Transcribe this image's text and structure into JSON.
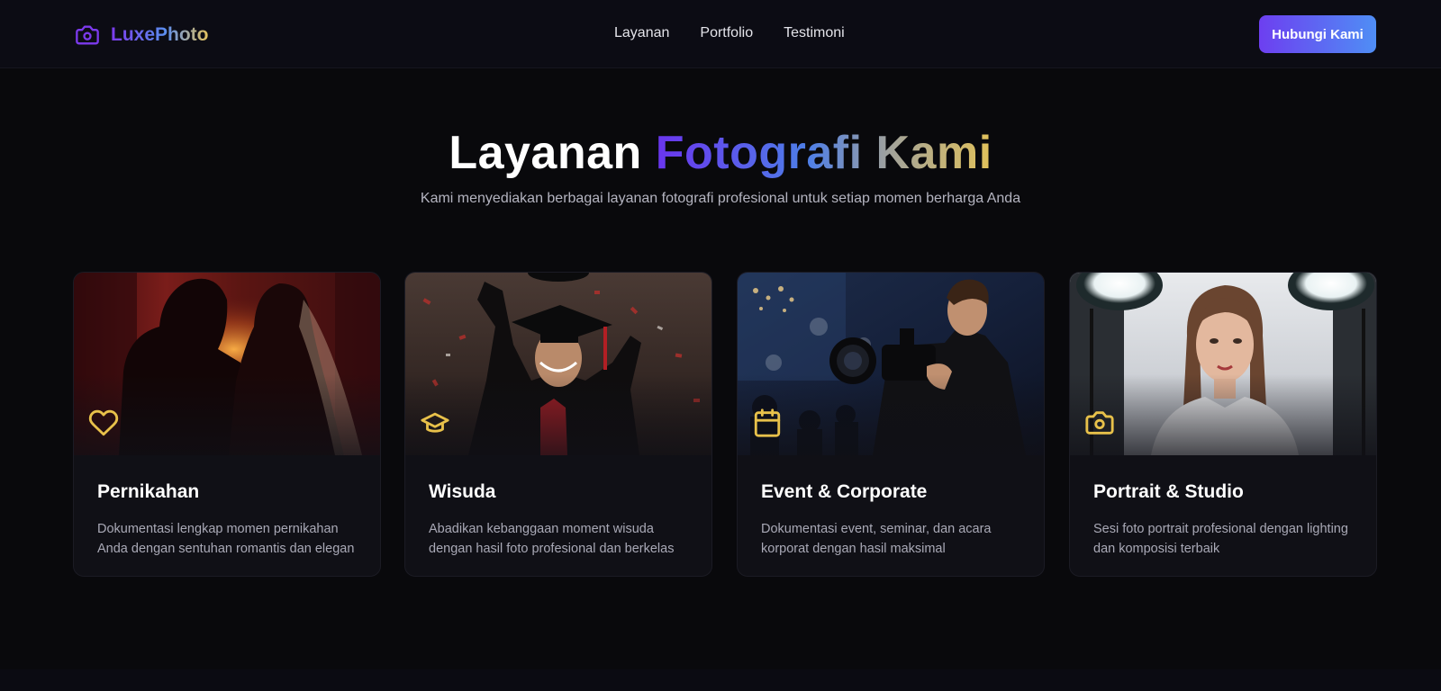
{
  "brand": {
    "name": "LuxePhoto",
    "icon": "camera-icon"
  },
  "nav": {
    "links": [
      "Layanan",
      "Portfolio",
      "Testimoni"
    ],
    "cta_label": "Hubungi Kami"
  },
  "hero": {
    "title_plain": "Layanan",
    "title_gradient": "Fotografi Kami",
    "subtitle": "Kami menyediakan berbagai layanan fotografi profesional untuk setiap momen berharga Anda"
  },
  "services": [
    {
      "title": "Pernikahan",
      "description": "Dokumentasi lengkap momen pernikahan Anda dengan sentuhan romantis dan elegan",
      "icon": "heart-icon"
    },
    {
      "title": "Wisuda",
      "description": "Abadikan kebanggaan moment wisuda dengan hasil foto profesional dan berkelas",
      "icon": "graduation-cap-icon"
    },
    {
      "title": "Event & Corporate",
      "description": "Dokumentasi event, seminar, dan acara korporat dengan hasil maksimal",
      "icon": "calendar-icon"
    },
    {
      "title": "Portrait & Studio",
      "description": "Sesi foto portrait profesional dengan lighting dan komposisi terbaik",
      "icon": "camera-icon"
    }
  ],
  "colors": {
    "accent_purple": "#6d3ff0",
    "accent_blue": "#4f8ef5",
    "accent_gold": "#e8c14a",
    "background": "#09090c"
  }
}
